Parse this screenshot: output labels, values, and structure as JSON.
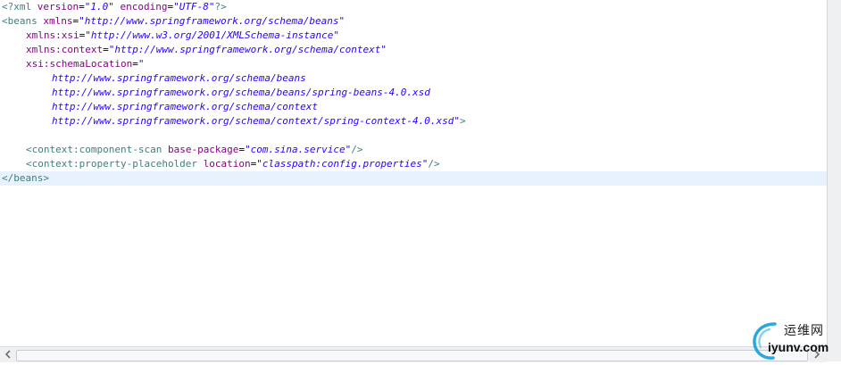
{
  "editor": {
    "lines": [
      [
        {
          "t": "<?xml ",
          "c": "tag"
        },
        {
          "t": "version",
          "c": "attr"
        },
        {
          "t": "=",
          "c": "plain"
        },
        {
          "t": "\"1.0\"",
          "c": "val"
        },
        {
          "t": " ",
          "c": "plain"
        },
        {
          "t": "encoding",
          "c": "attr"
        },
        {
          "t": "=",
          "c": "plain"
        },
        {
          "t": "\"UTF-8\"",
          "c": "val"
        },
        {
          "t": "?>",
          "c": "tag"
        }
      ],
      [
        {
          "t": "<beans ",
          "c": "tag"
        },
        {
          "t": "xmlns",
          "c": "attr"
        },
        {
          "t": "=",
          "c": "plain"
        },
        {
          "t": "\"http://www.springframework.org/schema/beans\"",
          "c": "val"
        }
      ],
      [
        {
          "t": "xmlns:xsi",
          "c": "attr"
        },
        {
          "t": "=",
          "c": "plain"
        },
        {
          "t": "\"http://www.w3.org/2001/XMLSchema-instance\"",
          "c": "val"
        }
      ],
      [
        {
          "t": "xmlns:context",
          "c": "attr"
        },
        {
          "t": "=",
          "c": "plain"
        },
        {
          "t": "\"http://www.springframework.org/schema/context\"",
          "c": "val"
        }
      ],
      [
        {
          "t": "xsi:schemaLocation",
          "c": "attr"
        },
        {
          "t": "=",
          "c": "plain"
        },
        {
          "t": "\"",
          "c": "val"
        }
      ],
      [
        {
          "t": "http://www.springframework.org/schema/beans",
          "c": "val"
        }
      ],
      [
        {
          "t": "http://www.springframework.org/schema/beans/spring-beans-4.0.xsd",
          "c": "val"
        }
      ],
      [
        {
          "t": "http://www.springframework.org/schema/context",
          "c": "val"
        }
      ],
      [
        {
          "t": "http://www.springframework.org/schema/context/spring-context-4.0.xsd\"",
          "c": "val"
        },
        {
          "t": ">",
          "c": "tag"
        }
      ],
      [],
      [
        {
          "t": "<context:component-scan ",
          "c": "tag"
        },
        {
          "t": "base-package",
          "c": "attr"
        },
        {
          "t": "=",
          "c": "plain"
        },
        {
          "t": "\"com.sina.service\"",
          "c": "val"
        },
        {
          "t": "/>",
          "c": "tag"
        }
      ],
      [
        {
          "t": "<context:property-placeholder ",
          "c": "tag"
        },
        {
          "t": "location",
          "c": "attr"
        },
        {
          "t": "=",
          "c": "plain"
        },
        {
          "t": "\"classpath:config.properties\"",
          "c": "val"
        },
        {
          "t": "/>",
          "c": "tag"
        }
      ],
      [
        {
          "t": "</beans>",
          "c": "tag"
        }
      ]
    ]
  },
  "scrollbars": {
    "left_arrow_icon": "chevron-left-icon",
    "right_arrow_icon": "chevron-right-icon"
  },
  "watermark": {
    "cn_text": "运维网",
    "en_text": "iyunv.com"
  },
  "colors": {
    "tag": "#3f7f7f",
    "attr": "#7f007f",
    "value": "#2a00ff",
    "current_line": "#e8f2fe"
  }
}
